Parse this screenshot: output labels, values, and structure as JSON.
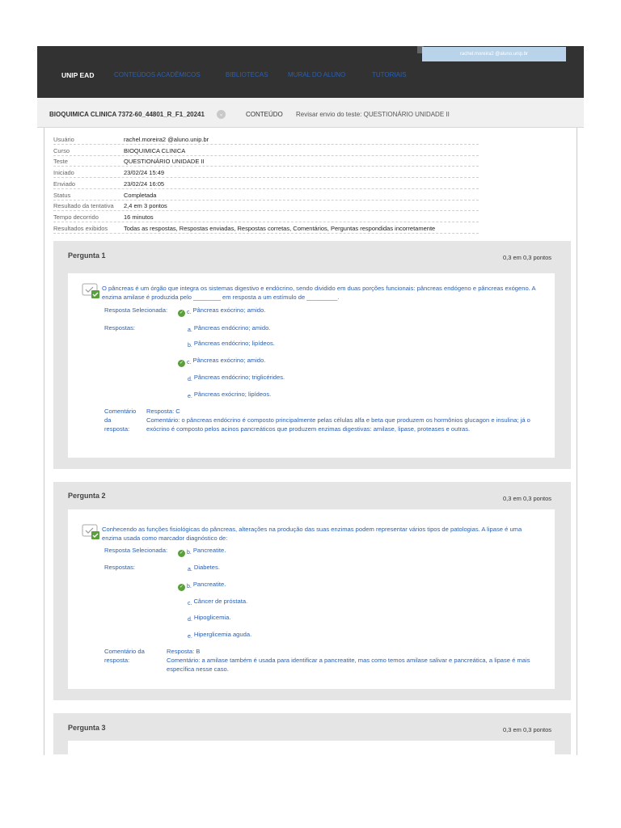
{
  "header": {
    "user_label": "rachel.moreira2 @aluno.unip.br",
    "home": "UNIP EAD",
    "nav_items": [
      "CONTEÚDOS ACADÊMICOS",
      "BIBLIOTECAS",
      "MURAL DO ALUNO",
      "TUTORIAIS"
    ]
  },
  "breadcrumb": {
    "course": "BIOQUIMICA CLINICA 7372-60_44801_R_F1_20241",
    "section": "CONTEÚDO",
    "current": "Revisar envio do teste: QUESTIONÁRIO UNIDADE II"
  },
  "info": [
    {
      "label": "Usuário",
      "value": "rachel.moreira2 @aluno.unip.br"
    },
    {
      "label": "Curso",
      "value": "BIOQUIMICA CLINICA"
    },
    {
      "label": "Teste",
      "value": "QUESTIONÁRIO UNIDADE II"
    },
    {
      "label": "Iniciado",
      "value": "23/02/24 15:49"
    },
    {
      "label": "Enviado",
      "value": "23/02/24 16:05"
    },
    {
      "label": "Status",
      "value": "Completada"
    },
    {
      "label": "Resultado da tentativa",
      "value": "2,4 em 3 pontos"
    },
    {
      "label": "Tempo decorrido",
      "value": "16 minutos"
    },
    {
      "label": "Resultados exibidos",
      "value": "Todas as respostas, Respostas enviadas, Respostas corretas, Comentários, Perguntas respondidas incorretamente"
    }
  ],
  "questions": [
    {
      "title": "Pergunta 1",
      "score": "0,3 em 0,3 pontos",
      "text": "O pâncreas é um órgão que integra os sistemas digestivo e endócrino, sendo dividido em duas porções funcionais: pâncreas endógeno e pâncreas exógeno. A enzima amilase é produzida pelo ________ em resposta a um estímulo de _________.",
      "selected_label": "Resposta Selecionada:",
      "selected_letter": "c.",
      "selected_text": "Pâncreas exócrino; amido.",
      "answers_label": "Respostas:",
      "options": [
        {
          "letter": "a.",
          "text": "Pâncreas endócrino; amido.",
          "correct": false
        },
        {
          "letter": "b.",
          "text": "Pâncreas endócrino; lipídeos.",
          "correct": false
        },
        {
          "letter": "c.",
          "text": "Pâncreas exócrino; amido.",
          "correct": true
        },
        {
          "letter": "d.",
          "text": "Pâncreas endócrino; triglicérides.",
          "correct": false
        },
        {
          "letter": "e.",
          "text": "Pâncreas exócrino; lipídeos.",
          "correct": false
        }
      ],
      "comment_label_1": "Comentário",
      "comment_label_2": "da",
      "comment_label_3": "resposta:",
      "comment_answer": "Resposta: C",
      "comment_text": "Comentário: o pâncreas endócrino é composto principalmente pelas células alfa e beta que produzem os hormônios glucagon e insulina; já o exócrino é composto pelos acinos pancreáticos que produzem enzimas digestivas: amilase, lipase, proteases e outras."
    },
    {
      "title": "Pergunta 2",
      "score": "0,3 em 0,3 pontos",
      "text": "Conhecendo as funções fisiológicas do pâncreas, alterações na produção das suas enzimas podem representar vários tipos de patologias. A lipase é uma enzima usada como marcador diagnóstico de:",
      "selected_label": "Resposta Selecionada:",
      "selected_letter": "b.",
      "selected_text": "Pancreatite.",
      "answers_label": "Respostas:",
      "options": [
        {
          "letter": "a.",
          "text": "Diabetes.",
          "correct": false
        },
        {
          "letter": "b.",
          "text": "Pancreatite.",
          "correct": true
        },
        {
          "letter": "c.",
          "text": "Câncer de próstata.",
          "correct": false
        },
        {
          "letter": "d.",
          "text": "Hipoglicemia.",
          "correct": false
        },
        {
          "letter": "e.",
          "text": "Hiperglicemia aguda.",
          "correct": false
        }
      ],
      "comment_label_1": "Comentário da",
      "comment_label_2": "resposta:",
      "comment_answer": "Resposta: B",
      "comment_text": "Comentário: a amilase também é usada para identificar a pancreatite, mas como temos amilase salivar e pancreática, a lipase é mais específica nesse caso."
    },
    {
      "title": "Pergunta 3",
      "score": "0,3 em 0,3 pontos"
    }
  ],
  "colors": {
    "header_bg": "#323232",
    "link": "#2b5fb0",
    "panel": "#e5e5e5",
    "check": "#5aa03a"
  }
}
